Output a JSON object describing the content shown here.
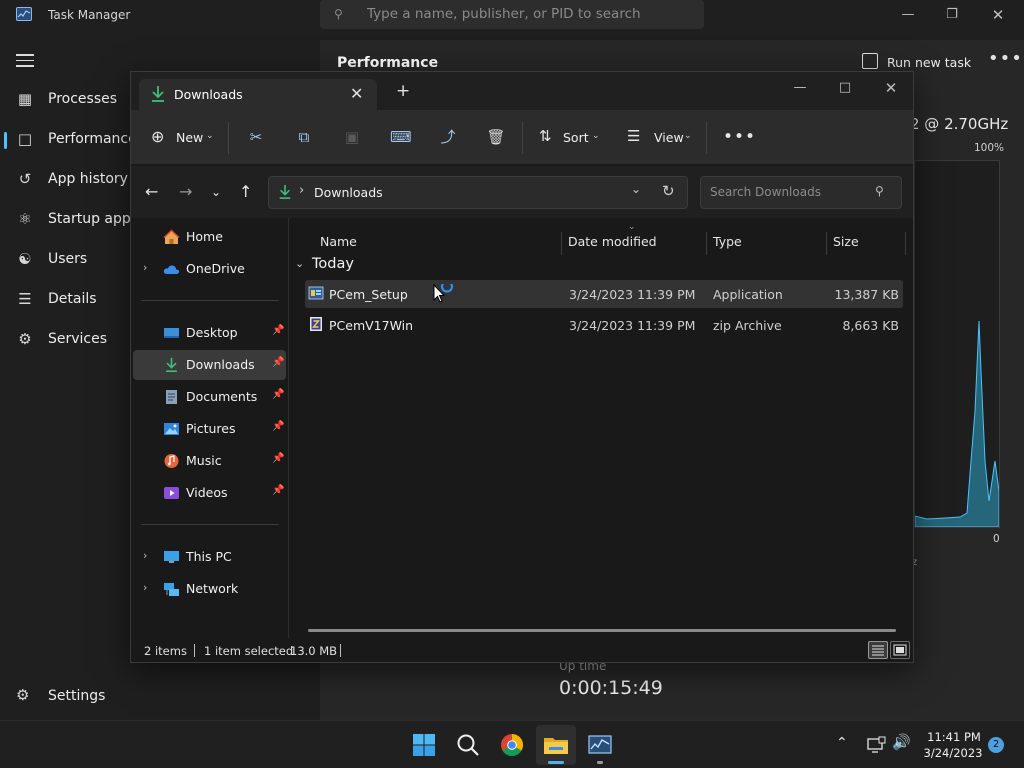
{
  "task_manager": {
    "title": "Task Manager",
    "search_placeholder": "Type a name, publisher, or PID to search",
    "nav": [
      {
        "label": "Processes"
      },
      {
        "label": "Performance"
      },
      {
        "label": "App history"
      },
      {
        "label": "Startup apps"
      },
      {
        "label": "Users"
      },
      {
        "label": "Details"
      },
      {
        "label": "Services"
      }
    ],
    "settings_label": "Settings",
    "page_title": "Performance",
    "run_new_task": "Run new task",
    "cpu_speed": "2 @ 2.70GHz",
    "graph_max": "100%",
    "graph_min": "0",
    "graph_side_label": "z",
    "uptime_label": "Up time",
    "uptime_value": "0:00:15:49",
    "accent_color": "#4cc2ff"
  },
  "explorer": {
    "tab_label": "Downloads",
    "toolbar": {
      "new_label": "New",
      "sort_label": "Sort",
      "view_label": "View"
    },
    "address": {
      "path": "Downloads"
    },
    "search_placeholder": "Search Downloads",
    "nav": {
      "home": "Home",
      "onedrive": "OneDrive",
      "quick": [
        {
          "label": "Desktop"
        },
        {
          "label": "Downloads"
        },
        {
          "label": "Documents"
        },
        {
          "label": "Pictures"
        },
        {
          "label": "Music"
        },
        {
          "label": "Videos"
        }
      ],
      "this_pc": "This PC",
      "network": "Network"
    },
    "columns": {
      "name": "Name",
      "date": "Date modified",
      "type": "Type",
      "size": "Size"
    },
    "group_label": "Today",
    "files": [
      {
        "name": "PCem_Setup",
        "date": "3/24/2023 11:39 PM",
        "type": "Application",
        "size": "13,387 KB",
        "selected": true
      },
      {
        "name": "PCemV17Win",
        "date": "3/24/2023 11:39 PM",
        "type": "zip Archive",
        "size": "8,663 KB",
        "selected": false
      }
    ],
    "status": {
      "items": "2 items",
      "selected": "1 item selected",
      "size": "13.0 MB"
    }
  },
  "tray": {
    "time": "11:41 PM",
    "date": "3/24/2023",
    "notification_count": "2"
  }
}
